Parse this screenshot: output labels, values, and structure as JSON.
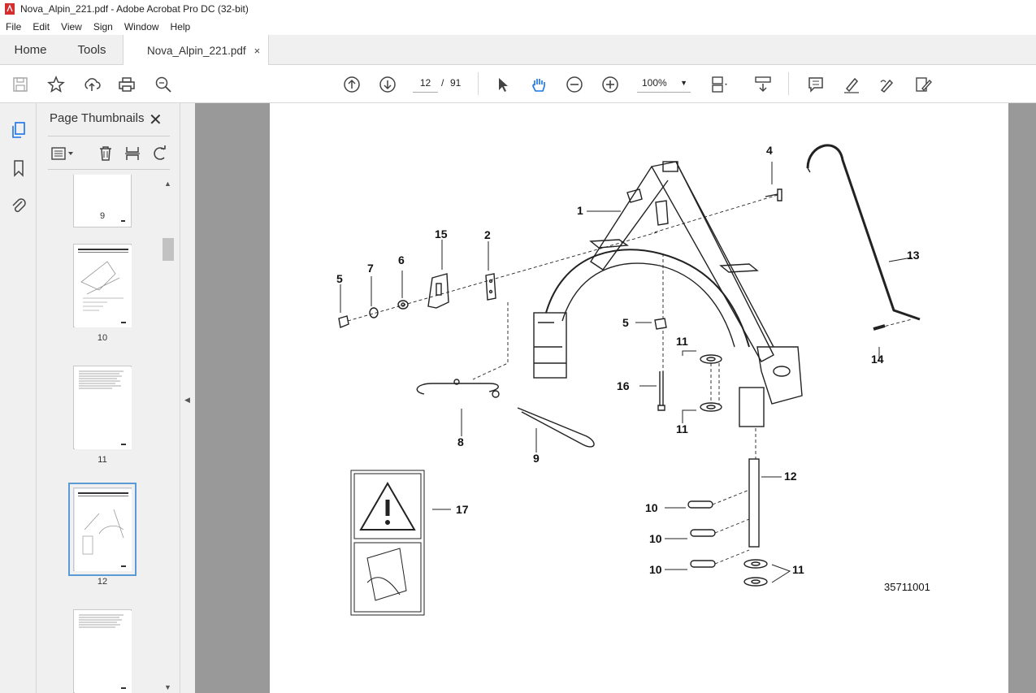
{
  "window": {
    "title": "Nova_Alpin_221.pdf - Adobe Acrobat Pro DC (32-bit)"
  },
  "menu": [
    "File",
    "Edit",
    "View",
    "Sign",
    "Window",
    "Help"
  ],
  "tabs": {
    "home": "Home",
    "tools": "Tools",
    "document": "Nova_Alpin_221.pdf",
    "close": "×"
  },
  "toolbar": {
    "current_page": "12",
    "page_separator": "/",
    "total_pages": "91",
    "zoom": "100%",
    "icons": [
      "save-icon",
      "bookmark-star-icon",
      "upload-icon",
      "print-icon",
      "zoom-search-icon",
      "page-up-icon",
      "page-down-icon",
      "select-arrow-icon",
      "hand-icon",
      "zoom-out-icon",
      "zoom-in-icon",
      "fit-page-icon",
      "scroll-mode-icon",
      "comment-icon",
      "highlight-icon",
      "draw-icon",
      "fill-sign-icon"
    ]
  },
  "left_rail": {
    "icons": [
      "page-thumbnails-icon",
      "bookmarks-icon",
      "attachments-icon"
    ]
  },
  "panel": {
    "title": "Page Thumbnails",
    "close": "✕",
    "tools": [
      "thumbnail-options-icon",
      "delete-page-icon",
      "insert-page-icon",
      "rotate-icon"
    ],
    "thumbnails": [
      {
        "label": "9",
        "selected": false
      },
      {
        "label": "10",
        "selected": false
      },
      {
        "label": "11",
        "selected": false
      },
      {
        "label": "12",
        "selected": true
      },
      {
        "label": "",
        "selected": false
      }
    ]
  },
  "document": {
    "callouts": [
      "1",
      "2",
      "4",
      "5",
      "6",
      "7",
      "15",
      "13",
      "5",
      "11",
      "16",
      "11",
      "14",
      "8",
      "9",
      "12",
      "17",
      "10",
      "10",
      "10",
      "11"
    ],
    "drawing_number": "35711001"
  }
}
